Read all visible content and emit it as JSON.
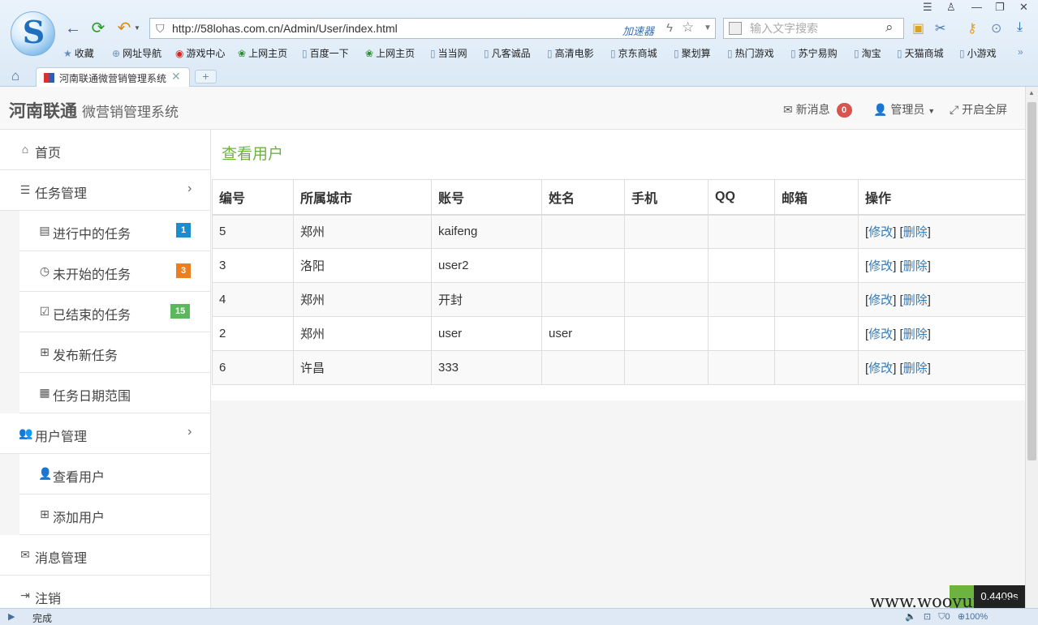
{
  "browser": {
    "url": "http://58lohas.com.cn/Admin/User/index.html",
    "accelerator": "加速器",
    "search_placeholder": "输入文字搜索",
    "tab_title": "河南联通微营销管理系统",
    "new_tab": "+",
    "status": "完成",
    "zoom": "100%",
    "status_count": "0",
    "bookmarks": [
      "收藏",
      "网址导航",
      "游戏中心",
      "上网主页",
      "百度一下",
      "上网主页",
      "当当网",
      "凡客诚品",
      "高清电影",
      "京东商城",
      "聚划算",
      "热门游戏",
      "苏宁易购",
      "淘宝",
      "天猫商城",
      "小游戏"
    ]
  },
  "header": {
    "brand": "河南联通",
    "subtitle": "微营销管理系统",
    "messages_label": "新消息",
    "messages_count": "0",
    "admin_label": "管理员",
    "fullscreen_label": "开启全屏"
  },
  "sidebar": {
    "home": "首页",
    "task_mgmt": "任务管理",
    "tasks_running": "进行中的任务",
    "tasks_running_count": "1",
    "tasks_pending": "未开始的任务",
    "tasks_pending_count": "3",
    "tasks_done": "已结束的任务",
    "tasks_done_count": "15",
    "publish_task": "发布新任务",
    "task_date_range": "任务日期范围",
    "user_mgmt": "用户管理",
    "view_users": "查看用户",
    "add_user": "添加用户",
    "msg_mgmt": "消息管理",
    "logout": "注销"
  },
  "main": {
    "title": "查看用户",
    "columns": [
      "编号",
      "所属城市",
      "账号",
      "姓名",
      "手机",
      "QQ",
      "邮箱",
      "操作"
    ],
    "edit_label": "修改",
    "delete_label": "删除",
    "rows": [
      {
        "id": "5",
        "city": "郑州",
        "account": "kaifeng",
        "name": "",
        "phone": "",
        "qq": "",
        "email": ""
      },
      {
        "id": "3",
        "city": "洛阳",
        "account": "user2",
        "name": "",
        "phone": "",
        "qq": "",
        "email": ""
      },
      {
        "id": "4",
        "city": "郑州",
        "account": "开封",
        "name": "",
        "phone": "",
        "qq": "",
        "email": ""
      },
      {
        "id": "2",
        "city": "郑州",
        "account": "user",
        "name": "user",
        "phone": "",
        "qq": "",
        "email": ""
      },
      {
        "id": "6",
        "city": "许昌",
        "account": "333",
        "name": "",
        "phone": "",
        "qq": "",
        "email": ""
      }
    ]
  },
  "timer": "0.4409s",
  "watermark": "www.wooyun.org",
  "colors": {
    "accent_green": "#6cb33e",
    "link": "#337ab7",
    "badge_red": "#d9534f",
    "badge_blue": "#1a8ccf",
    "badge_orange": "#ee7d1e",
    "badge_green": "#5cb85c"
  }
}
